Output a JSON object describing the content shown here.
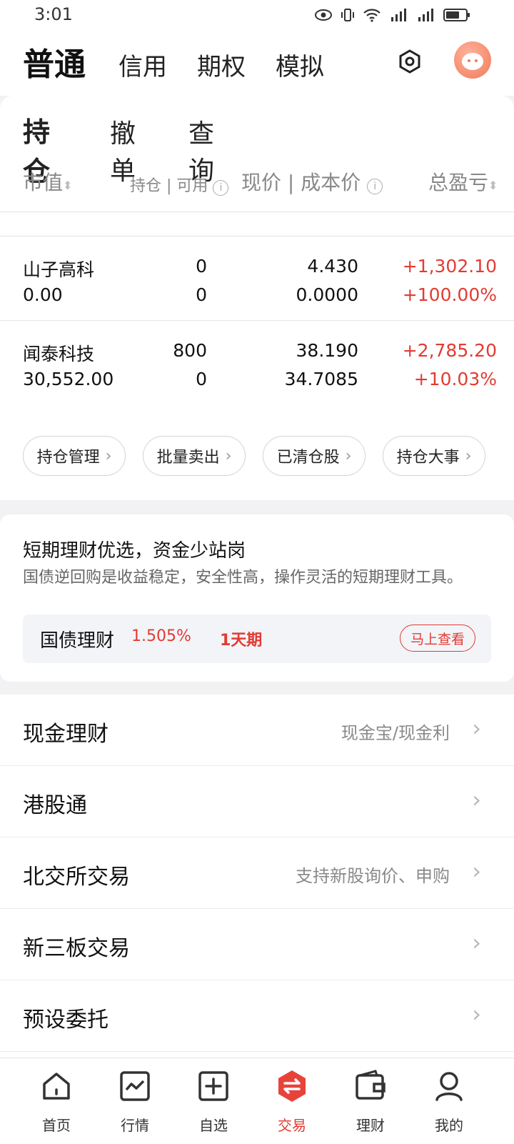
{
  "status": {
    "time": "3:01"
  },
  "header": {
    "tabs": [
      "普通",
      "信用",
      "期权",
      "模拟"
    ],
    "active_tab": "普通"
  },
  "positions": {
    "subtabs": [
      "持仓",
      "撤单",
      "查询"
    ],
    "columns": {
      "market_value": "市值",
      "holding": "持仓",
      "available": "可用",
      "price": "现价",
      "cost": "成本价",
      "pnl": "总盈亏"
    },
    "rows": [
      {
        "name": "山子高科",
        "market_value": "0.00",
        "holding": "0",
        "available": "0",
        "price": "4.430",
        "cost": "0.0000",
        "pnl": "+1,302.10",
        "pnl_pct": "+100.00%"
      },
      {
        "name": "闻泰科技",
        "market_value": "30,552.00",
        "holding": "800",
        "available": "0",
        "price": "38.190",
        "cost": "34.7085",
        "pnl": "+2,785.20",
        "pnl_pct": "+10.03%"
      }
    ],
    "actions": [
      "持仓管理",
      "批量卖出",
      "已清仓股",
      "持仓大事"
    ]
  },
  "promo": {
    "title": "短期理财优选，资金少站岗",
    "desc": "国债逆回购是收益稳定，安全性高，操作灵活的短期理财工具。",
    "product": "国债理财",
    "rate": "1.505%",
    "term": "1天期",
    "button": "马上查看"
  },
  "menu": [
    {
      "label": "现金理财",
      "sub": "现金宝/现金利"
    },
    {
      "label": "港股通",
      "sub": ""
    },
    {
      "label": "北交所交易",
      "sub": "支持新股询价、申购"
    },
    {
      "label": "新三板交易",
      "sub": ""
    },
    {
      "label": "预设委托",
      "sub": ""
    }
  ],
  "nav": [
    {
      "label": "首页",
      "icon": "home-icon"
    },
    {
      "label": "行情",
      "icon": "chart-icon"
    },
    {
      "label": "自选",
      "icon": "add-icon"
    },
    {
      "label": "交易",
      "icon": "trade-icon"
    },
    {
      "label": "理财",
      "icon": "wallet-icon"
    },
    {
      "label": "我的",
      "icon": "user-icon"
    }
  ],
  "colors": {
    "accent": "#e23b32",
    "gain": "#e23b32",
    "loss": "#1a9d4c"
  }
}
